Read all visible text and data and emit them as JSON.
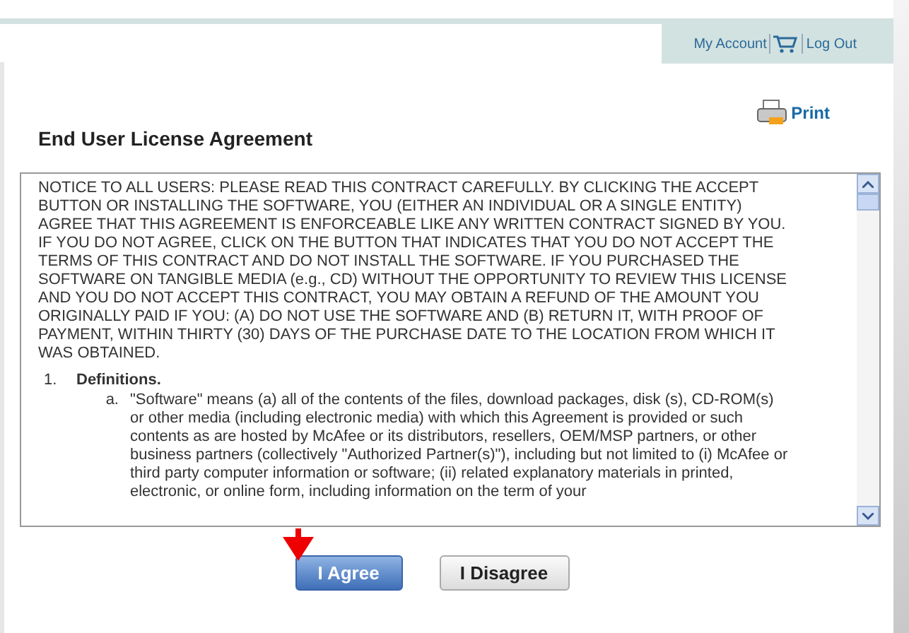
{
  "header_links": {
    "account": "My Account",
    "logout": "Log Out"
  },
  "print": {
    "label": "Print"
  },
  "title": "End User License Agreement",
  "license": {
    "notice": "NOTICE TO ALL USERS: PLEASE READ THIS CONTRACT CAREFULLY. BY CLICKING THE ACCEPT BUTTON OR INSTALLING THE SOFTWARE, YOU (EITHER AN INDIVIDUAL OR A SINGLE ENTITY) AGREE THAT THIS AGREEMENT IS ENFORCEABLE LIKE ANY WRITTEN CONTRACT SIGNED BY YOU. IF YOU DO NOT AGREE, CLICK ON THE BUTTON THAT INDICATES THAT YOU DO NOT ACCEPT THE TERMS OF THIS CONTRACT AND DO NOT INSTALL THE SOFTWARE. IF YOU PURCHASED THE SOFTWARE ON TANGIBLE MEDIA (e.g., CD) WITHOUT THE OPPORTUNITY TO REVIEW THIS LICENSE AND YOU DO NOT ACCEPT THIS CONTRACT, YOU MAY OBTAIN A REFUND OF THE AMOUNT YOU ORIGINALLY PAID IF YOU: (A) DO NOT USE THE SOFTWARE AND (B) RETURN IT, WITH PROOF OF PAYMENT, WITHIN THIRTY (30) DAYS OF THE PURCHASE DATE TO THE LOCATION FROM WHICH IT WAS OBTAINED.",
    "sections": [
      {
        "number": "1.",
        "heading": "Definitions.",
        "items": [
          {
            "letter": "a.",
            "text": "\"Software\" means (a) all of the contents of the files, download packages, disk (s), CD-ROM(s) or other media (including electronic media) with which this Agreement is provided or such contents as are hosted by McAfee or its distributors, resellers, OEM/MSP partners, or other business partners (collectively \"Authorized Partner(s)\"), including but not limited to (i) McAfee or third party computer information or software; (ii) related explanatory materials in printed, electronic, or online form, including information on the term of your"
          }
        ]
      }
    ]
  },
  "buttons": [
    {
      "label": "I Agree",
      "primary": true
    },
    {
      "label": "I Disagree",
      "primary": false
    }
  ]
}
